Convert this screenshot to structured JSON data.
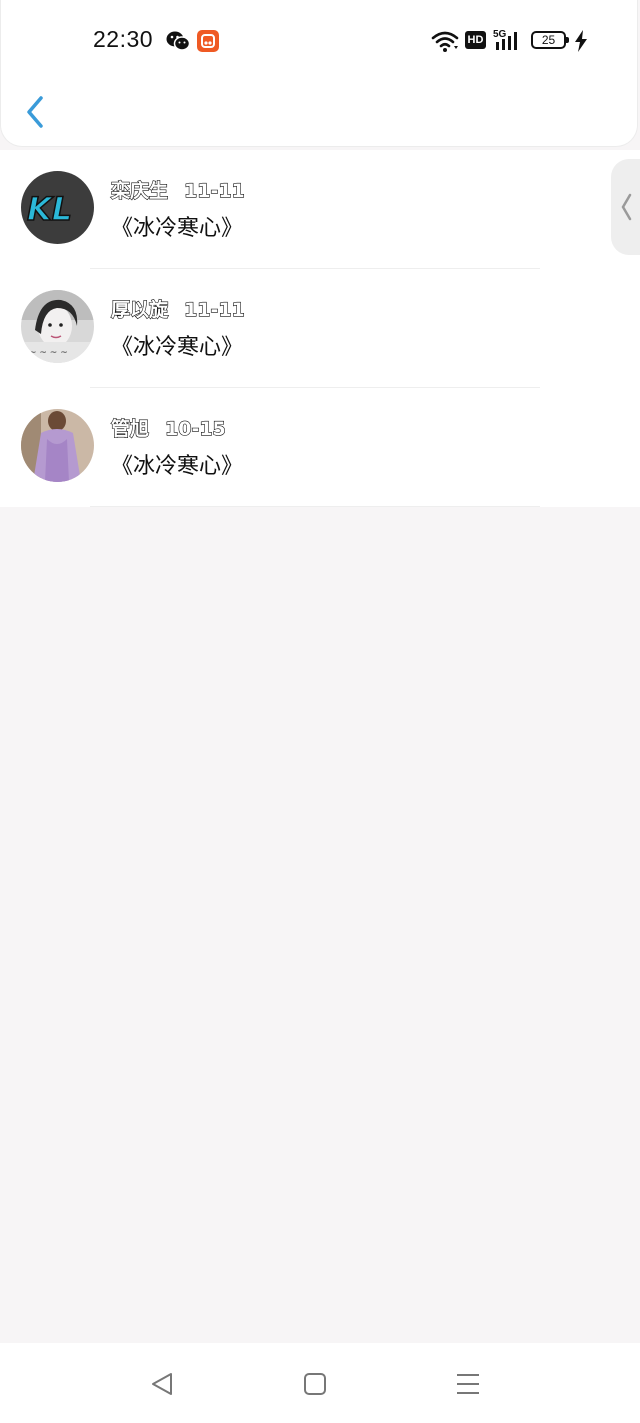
{
  "status_bar": {
    "time": "22:30",
    "network": "5G",
    "hd_label": "HD",
    "battery_level": "25",
    "icons": [
      "wechat-icon",
      "app-badge-icon",
      "wifi-icon",
      "hd-icon",
      "signal-icon",
      "battery-icon",
      "charging-icon"
    ]
  },
  "header": {
    "back_icon": "chevron-left-icon"
  },
  "colors": {
    "accent": "#3a9bd9",
    "background": "#f7f5f6",
    "card": "#ffffff"
  },
  "list": {
    "items": [
      {
        "name": "栾庆生",
        "date": "11-11",
        "message": "《冰冷寒心》",
        "avatar": "kl-logo-avatar"
      },
      {
        "name": "厚以旋",
        "date": "11-11",
        "message": "《冰冷寒心》",
        "avatar": "woman-portrait-avatar"
      },
      {
        "name": "管旭",
        "date": "10-15",
        "message": "《冰冷寒心》",
        "avatar": "purple-dress-avatar"
      }
    ]
  },
  "side_tab": {
    "icon": "chevron-left-icon"
  },
  "nav_bar": {
    "icons": [
      "nav-back-icon",
      "nav-home-icon",
      "nav-menu-icon"
    ]
  }
}
